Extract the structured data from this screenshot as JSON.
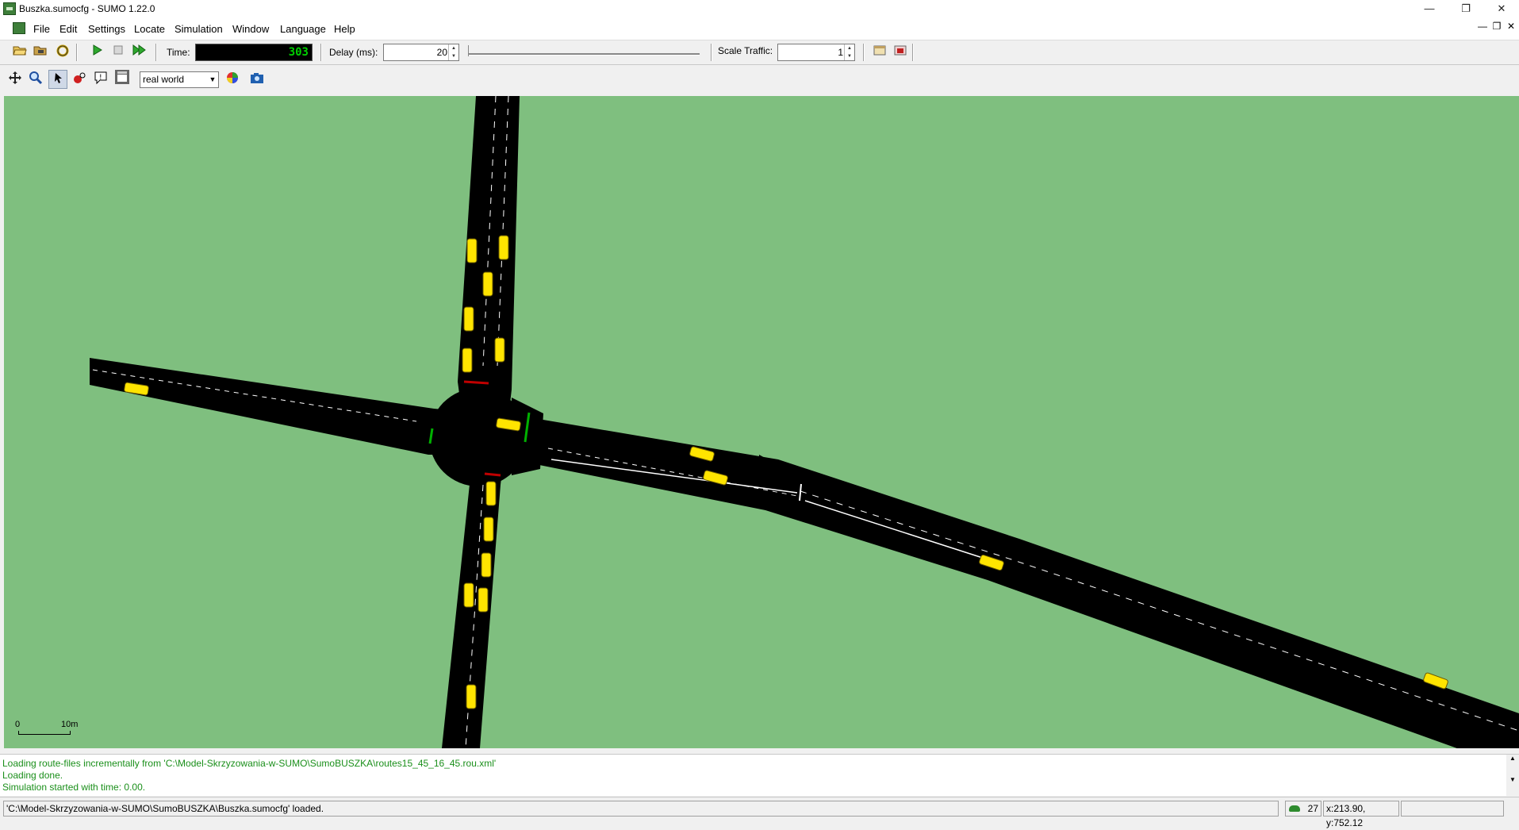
{
  "window": {
    "title": "Buszka.sumocfg - SUMO 1.22.0",
    "controls": [
      "minimize",
      "restore",
      "close"
    ]
  },
  "menu": {
    "items": [
      "File",
      "Edit",
      "Settings",
      "Locate",
      "Simulation",
      "Window",
      "Language",
      "Help"
    ]
  },
  "toolbar": {
    "time_label": "Time:",
    "time_value": "303",
    "delay_label": "Delay (ms):",
    "delay_value": "20",
    "delay_slider_fraction": 0.0,
    "scale_label": "Scale Traffic:",
    "scale_value": "1"
  },
  "view_toolbar": {
    "scheme_selected": "real world"
  },
  "scale_bar": {
    "start_label": "0",
    "end_label": "10m"
  },
  "log": {
    "lines": [
      "Loading route-files incrementally from 'C:\\Model-Skrzyzowania-w-SUMO\\SumoBUSZKA\\routes15_45_16_45.rou.xml'",
      "Loading done.",
      "Simulation started with time: 0.00."
    ],
    "color": "#1a8f1a"
  },
  "status": {
    "message": "'C:\\Model-Skrzyzowania-w-SUMO\\SumoBUSZKA\\Buszka.sumocfg' loaded.",
    "vehicle_count": "27",
    "coordinates": "x:213.90, y:752.12"
  },
  "colors": {
    "grass": "#7fbf7f",
    "road": "#000000",
    "vehicle": "#ffe400",
    "signal_green": "#00b000",
    "signal_red": "#c00000"
  }
}
